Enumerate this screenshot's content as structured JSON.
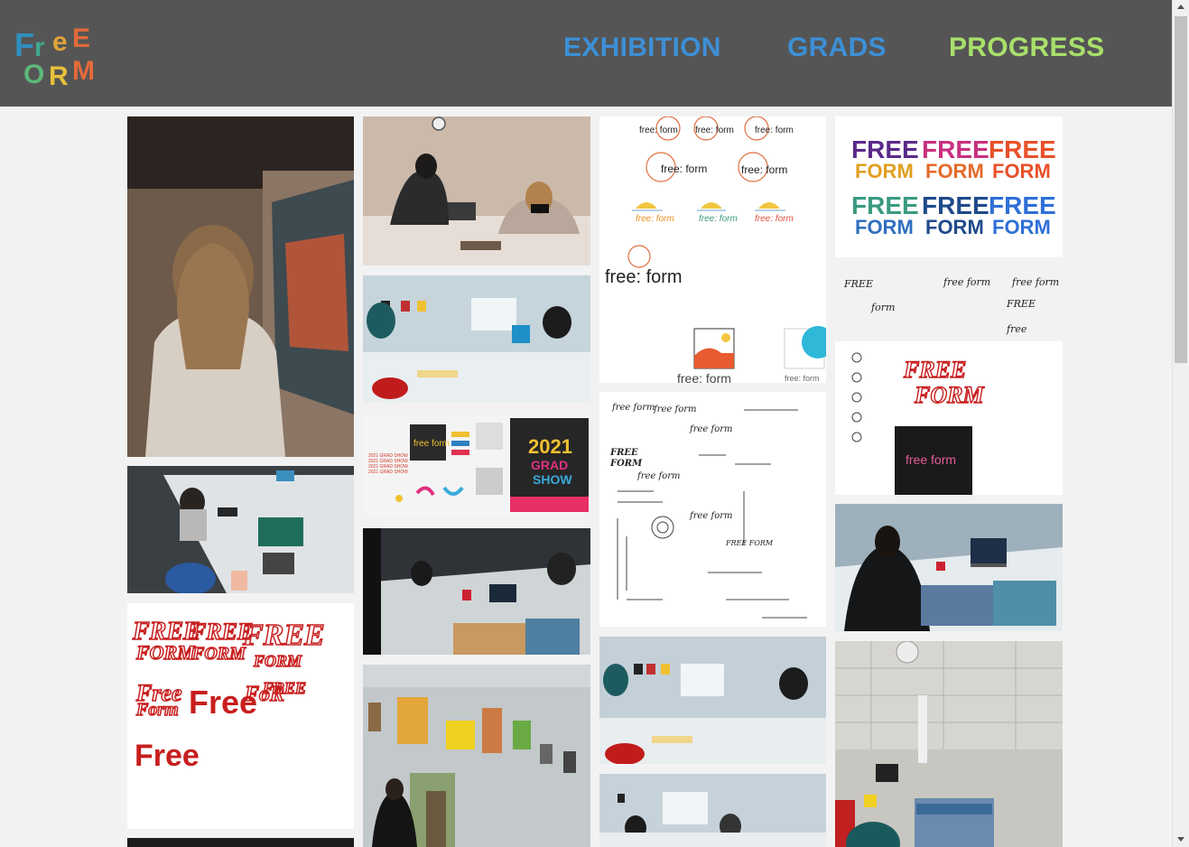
{
  "header": {
    "logo_alt": "FREE FORM",
    "nav": [
      {
        "label": "EXHIBITION",
        "color": "#3d8fd6"
      },
      {
        "label": "GRADS",
        "color": "#3d8fd6"
      },
      {
        "label": "PROGRESS",
        "color": "#a8e06a"
      }
    ]
  },
  "colors": {
    "header_bg": "#555555",
    "page_bg": "#f2f2f2",
    "nav_default": "#3d8fd6",
    "nav_active": "#a8e06a"
  },
  "gallery": {
    "sketch_a": {
      "row1": [
        "free: form",
        "free: form",
        "free: form"
      ],
      "row2": [
        "free: form",
        "free: form"
      ],
      "row3": [
        "free: form",
        "free: form",
        "free: form"
      ],
      "big": "free: form",
      "bottom": [
        "free: form",
        "free: form"
      ]
    },
    "board": {
      "poster_year": "2021",
      "poster_line1": "GRAD",
      "poster_line2": "SHOW",
      "show_lines": [
        "2021 GRAD SHOW",
        "2021 GRAD SHOW",
        "2021 GRAD SHOW",
        "2021 GRAD SHOW"
      ],
      "wordmark": "free form"
    },
    "logo_grid": {
      "top": "FREE",
      "bottom": "FORM"
    },
    "red_sketch": [
      "FREE",
      "FORM",
      "FREE",
      "FORM",
      "FREE",
      "FORM",
      "Free",
      "Form",
      "Free",
      "Free",
      "FoR",
      "FREE"
    ],
    "sketch_c": {
      "title1": "FREE",
      "title2": "FORM",
      "box": "free form"
    },
    "sketch_b": [
      "free form",
      "FREE",
      "FORM",
      "free form",
      "free form",
      "FREE FORM",
      "free form",
      "free form"
    ]
  }
}
